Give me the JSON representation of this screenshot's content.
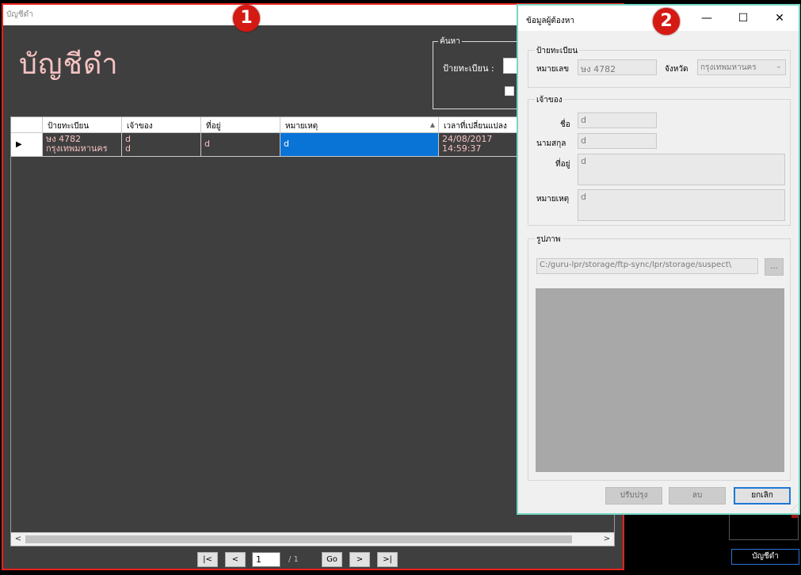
{
  "main_window": {
    "title": "บัญชีดำ",
    "heading": "บัญชีดำ",
    "search": {
      "legend": "ค้นหา",
      "plate_label": "ป้ายทะเบียน :"
    },
    "grid": {
      "columns": [
        "ป้ายทะเบียน",
        "เจ้าของ",
        "ที่อยู่",
        "หมายเหตุ",
        "เวลาที่เปลี่ยนแปลง"
      ],
      "rows": [
        {
          "plate_line1": "ษง 4782",
          "plate_line2": "กรุงเทพมหานคร",
          "owner_line1": "d",
          "owner_line2": "d",
          "address": "d",
          "note": "d",
          "changed_date": "24/08/2017",
          "changed_time": "14:59:37"
        }
      ]
    },
    "pager": {
      "first": "|<",
      "prev": "<",
      "page": "1",
      "total": "/ 1",
      "go": "Go",
      "next": ">",
      "last": ">|"
    }
  },
  "badges": {
    "one": "1",
    "two": "2"
  },
  "background": {
    "blacklist_button": "บัญชีดำ"
  },
  "dialog": {
    "title": "ข้อมูลผู้ต้องหา",
    "plate_group": {
      "legend": "ป้ายทะเบียน",
      "number_label": "หมายเลข",
      "number_value": "ษง 4782",
      "province_label": "จังหวัด",
      "province_value": "กรุงเทพมหานคร"
    },
    "owner_group": {
      "legend": "เจ้าของ",
      "name_label": "ชื่อ",
      "name_value": "d",
      "surname_label": "นามสกุล",
      "surname_value": "d",
      "address_label": "ที่อยู่",
      "address_value": "d",
      "note_label": "หมายเหตุ",
      "note_value": "d"
    },
    "photo_group": {
      "legend": "รูปภาพ",
      "path": "C:/guru-lpr/storage/ftp-sync/lpr/storage/suspect\\",
      "browse": "..."
    },
    "buttons": {
      "update": "ปรับปรุง",
      "delete": "ลบ",
      "cancel": "ยกเลิก"
    }
  },
  "colors": {
    "main_bg": "#3f3f3f",
    "accent_pink": "#f6c2c2",
    "selection_blue": "#0a74d6",
    "badge_red": "#d41a13",
    "dialog_border": "#76d6c5"
  }
}
